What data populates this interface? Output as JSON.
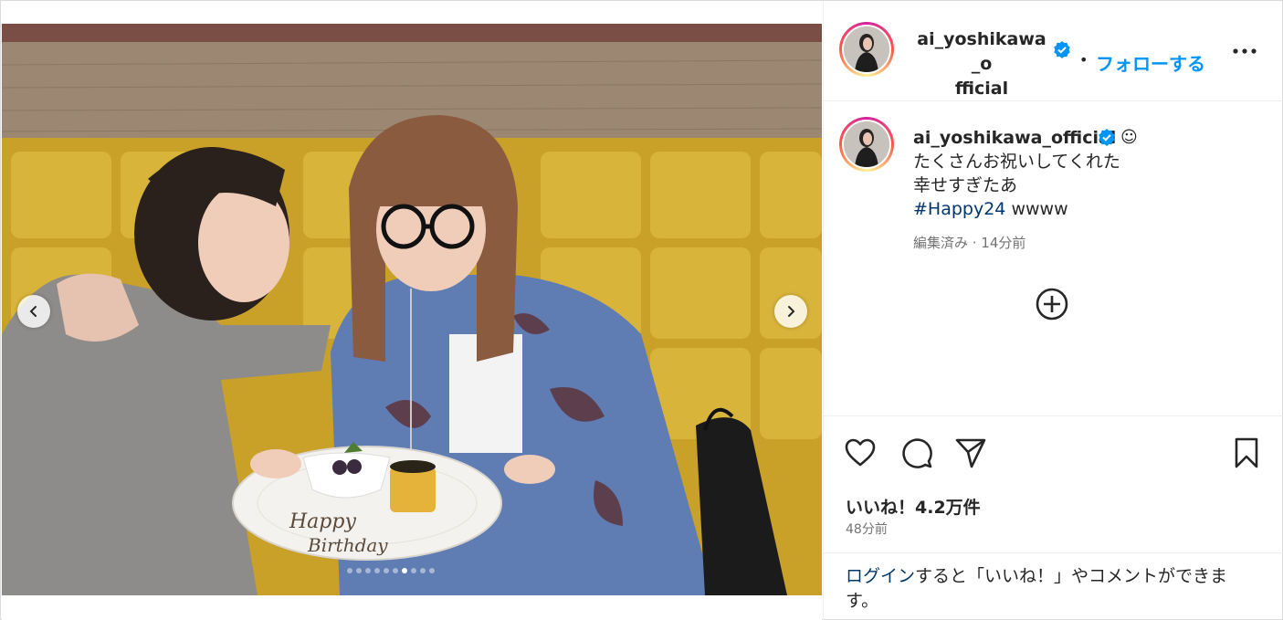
{
  "post": {
    "username_line1": "ai_yoshikawa_o",
    "username_line2": "fficial",
    "follow_label": "フォローする",
    "separator": "•",
    "photo_alt": "Two women at a table with a birthday cake plate",
    "plate_text_line1": "Happy",
    "plate_text_line2": "Birthday"
  },
  "caption": {
    "username": "ai_yoshikawa_official",
    "emoji": "☺",
    "line1": "たくさんお祝いしてくれた",
    "line2": "幸せすぎたあ",
    "hashtag": "#Happy24",
    "tail": " wwww",
    "meta": "編集済み · 14分前"
  },
  "carousel": {
    "count": 10,
    "active_index": 6
  },
  "engagement": {
    "likes": "いいね！4.2万件",
    "time": "48分前"
  },
  "login": {
    "link": "ログイン",
    "text": "すると「いいね！」やコメントができます。"
  },
  "icons": {
    "prev": "chevron-left-icon",
    "next": "chevron-right-icon",
    "verified": "verified-badge-icon",
    "more": "more-horizontal-icon",
    "add": "plus-circle-icon",
    "like": "heart-icon",
    "comment": "comment-icon",
    "share": "send-icon",
    "save": "bookmark-icon"
  },
  "colors": {
    "accent": "#0095f6",
    "verified": "#0095f6",
    "link": "#00376b",
    "muted": "#737373",
    "text": "#262626"
  }
}
